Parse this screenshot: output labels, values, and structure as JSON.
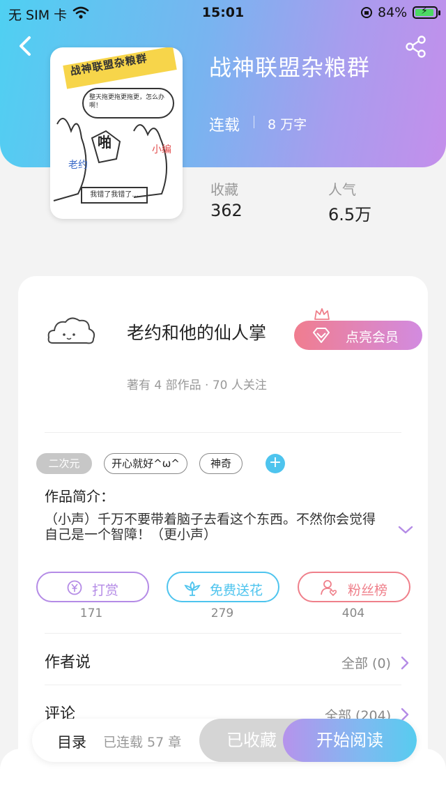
{
  "status_bar": {
    "carrier": "无 SIM 卡",
    "time": "15:01",
    "battery": "84%"
  },
  "book": {
    "title": "战神联盟杂粮群",
    "status": "连载",
    "words": "8 万字",
    "cover": {
      "title": "战神联盟杂粮群",
      "bubble": "整天拖更拖更拖更，怎么办啊！",
      "pa": "啪",
      "xiaobian": "小编",
      "laoyue": "老约",
      "sign": "我错了我错了..."
    },
    "stats": [
      {
        "label": "收藏",
        "value": "362"
      },
      {
        "label": "人气",
        "value": "6.5万"
      }
    ]
  },
  "author": {
    "name": "老约和他的仙人掌",
    "vip_button": "点亮会员",
    "stats_line": "著有 4 部作品 · 70 人关注"
  },
  "tags": [
    {
      "label": "二次元",
      "style": "filled"
    },
    {
      "label": "开心就好^ω^",
      "style": "outline"
    },
    {
      "label": "神奇",
      "style": "outline"
    }
  ],
  "intro": {
    "label": "作品简介：",
    "text": "（小声）千万不要带着脑子去看这个东西。不然你会觉得自己是一个智障！（更小声）"
  },
  "actions": [
    {
      "label": "打赏",
      "count": "171",
      "color": "#b48be6",
      "icon": "yen-icon"
    },
    {
      "label": "免费送花",
      "count": "279",
      "color": "#4ec4ee",
      "icon": "flower-icon"
    },
    {
      "label": "粉丝榜",
      "count": "404",
      "color": "#ef7f8a",
      "icon": "fans-icon"
    }
  ],
  "rows": [
    {
      "title": "作者说",
      "right": "全部 (0)"
    },
    {
      "title": "评论",
      "right": "全部 (204)"
    }
  ],
  "bottom": {
    "toc": "目录",
    "chapters": "已连载 57 章",
    "collected": "已收藏",
    "read": "开始阅读"
  },
  "colors": {
    "header_gradient": [
      "#4fd0f2",
      "#c48feb"
    ],
    "accent_purple": "#b48be6",
    "accent_blue": "#4ec4ee",
    "accent_pink": "#ef7f8a"
  }
}
